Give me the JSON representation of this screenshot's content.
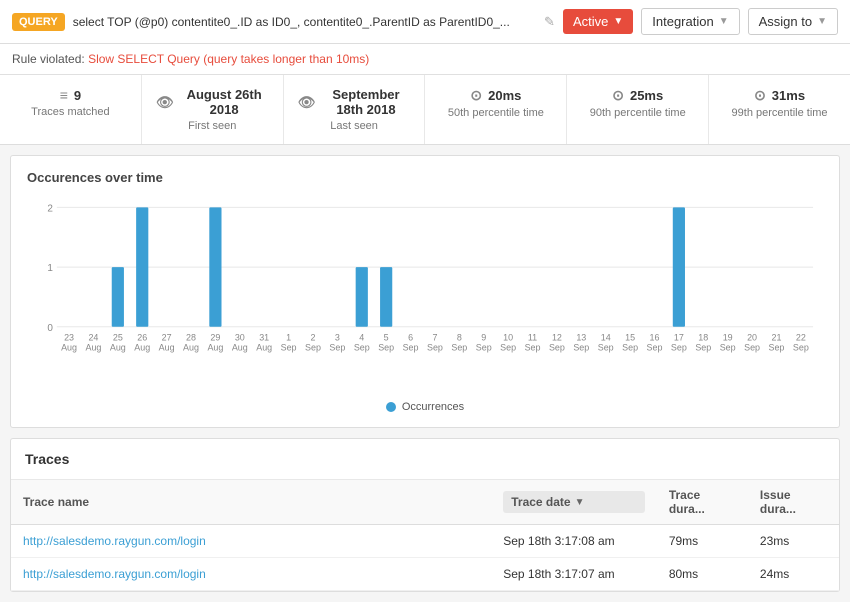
{
  "toolbar": {
    "badge": "QUERY",
    "query_text": "select TOP (@p0) contentite0_.ID as ID0_, contentite0_.ParentID as ParentID0_...",
    "edit_icon": "✎",
    "active_label": "Active",
    "integration_label": "Integration",
    "assignto_label": "Assign to"
  },
  "rule": {
    "prefix": "Rule violated:",
    "link_text": "Slow SELECT Query (query takes longer than 10ms)"
  },
  "stats": [
    {
      "icon": "≡",
      "value": "9",
      "label": "Traces matched"
    },
    {
      "icon": "👁",
      "value": "August 26th 2018",
      "label": "First seen"
    },
    {
      "icon": "👁",
      "value": "September 18th 2018",
      "label": "Last seen"
    },
    {
      "icon": "⊙",
      "value": "20ms",
      "label": "50th percentile time"
    },
    {
      "icon": "⊙",
      "value": "25ms",
      "label": "90th percentile time"
    },
    {
      "icon": "⊙",
      "value": "31ms",
      "label": "99th percentile time"
    }
  ],
  "chart": {
    "title": "Occurences over time",
    "legend": "Occurrences",
    "bars": [
      {
        "label": "23\nAug",
        "value": 0
      },
      {
        "label": "24\nAug",
        "value": 0
      },
      {
        "label": "25\nAug",
        "value": 1
      },
      {
        "label": "26\nAug",
        "value": 2
      },
      {
        "label": "27\nAug",
        "value": 0
      },
      {
        "label": "28\nAug",
        "value": 0
      },
      {
        "label": "29\nAug",
        "value": 2
      },
      {
        "label": "30\nAug",
        "value": 0
      },
      {
        "label": "31\nAug",
        "value": 0
      },
      {
        "label": "1\nSep",
        "value": 0
      },
      {
        "label": "2\nSep",
        "value": 0
      },
      {
        "label": "3\nSep",
        "value": 0
      },
      {
        "label": "4\nSep",
        "value": 1
      },
      {
        "label": "5\nSep",
        "value": 1
      },
      {
        "label": "6\nSep",
        "value": 0
      },
      {
        "label": "7\nSep",
        "value": 0
      },
      {
        "label": "8\nSep",
        "value": 0
      },
      {
        "label": "9\nSep",
        "value": 0
      },
      {
        "label": "10\nSep",
        "value": 0
      },
      {
        "label": "11\nSep",
        "value": 0
      },
      {
        "label": "12\nSep",
        "value": 0
      },
      {
        "label": "13\nSep",
        "value": 0
      },
      {
        "label": "14\nSep",
        "value": 0
      },
      {
        "label": "15\nSep",
        "value": 0
      },
      {
        "label": "16\nSep",
        "value": 0
      },
      {
        "label": "17\nSep",
        "value": 2
      },
      {
        "label": "18\nSep",
        "value": 0
      },
      {
        "label": "19\nSep",
        "value": 0
      },
      {
        "label": "20\nSep",
        "value": 0
      },
      {
        "label": "21\nSep",
        "value": 0
      },
      {
        "label": "22\nSep",
        "value": 0
      }
    ],
    "y_labels": [
      "0",
      "1",
      "2"
    ]
  },
  "traces": {
    "title": "Traces",
    "columns": [
      "Trace name",
      "Trace date",
      "Trace dura...",
      "Issue dura..."
    ],
    "rows": [
      {
        "name": "http://salesdemo.raygun.com/login",
        "date": "Sep 18th 3:17:08 am",
        "trace_dur": "79ms",
        "issue_dur": "23ms"
      },
      {
        "name": "http://salesdemo.raygun.com/login",
        "date": "Sep 18th 3:17:07 am",
        "trace_dur": "80ms",
        "issue_dur": "24ms"
      }
    ]
  }
}
